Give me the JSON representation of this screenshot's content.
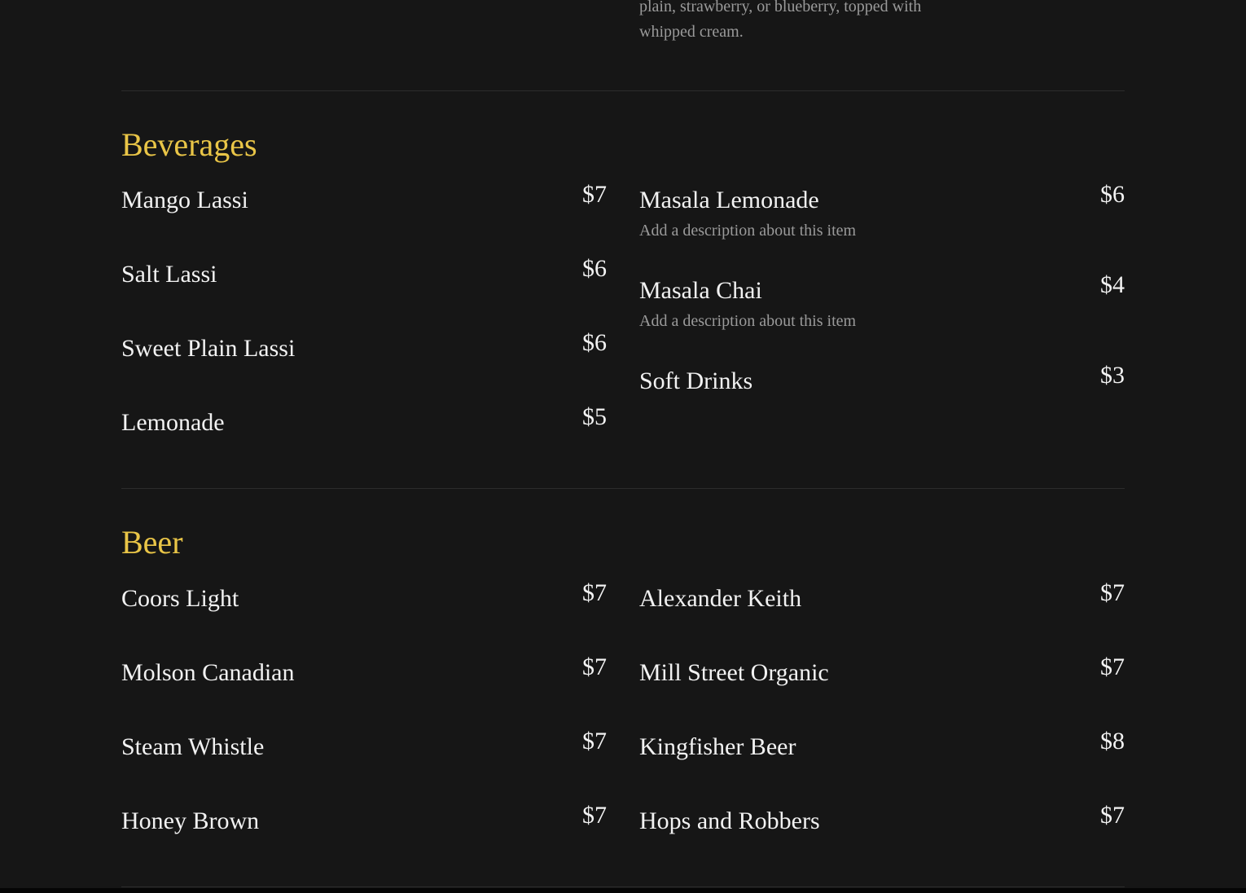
{
  "previous_item": {
    "description": "plain, strawberry, or blueberry, topped with whipped cream."
  },
  "sections": [
    {
      "title": "Beverages",
      "left_items": [
        {
          "name": "Mango Lassi",
          "price": "$7"
        },
        {
          "name": "Salt Lassi",
          "price": "$6"
        },
        {
          "name": "Sweet Plain Lassi",
          "price": "$6"
        },
        {
          "name": "Lemonade",
          "price": "$5"
        }
      ],
      "right_items": [
        {
          "name": "Masala Lemonade",
          "price": "$6",
          "description": "Add a description about this item"
        },
        {
          "name": "Masala Chai",
          "price": "$4",
          "description": "Add a description about this item"
        },
        {
          "name": "Soft Drinks",
          "price": "$3"
        }
      ]
    },
    {
      "title": "Beer",
      "left_items": [
        {
          "name": "Coors Light",
          "price": "$7"
        },
        {
          "name": "Molson Canadian",
          "price": "$7"
        },
        {
          "name": "Steam Whistle",
          "price": "$7"
        },
        {
          "name": "Honey Brown",
          "price": "$7"
        }
      ],
      "right_items": [
        {
          "name": "Alexander Keith",
          "price": "$7"
        },
        {
          "name": "Mill Street Organic",
          "price": "$7"
        },
        {
          "name": "Kingfisher Beer",
          "price": "$8"
        },
        {
          "name": "Hops and Robbers",
          "price": "$7"
        }
      ]
    }
  ],
  "colors": {
    "background": "#161616",
    "section_title": "#e9c547",
    "item_text": "#f2f2f2",
    "description_text": "#9a9a9a",
    "divider": "#2c2c2c"
  }
}
